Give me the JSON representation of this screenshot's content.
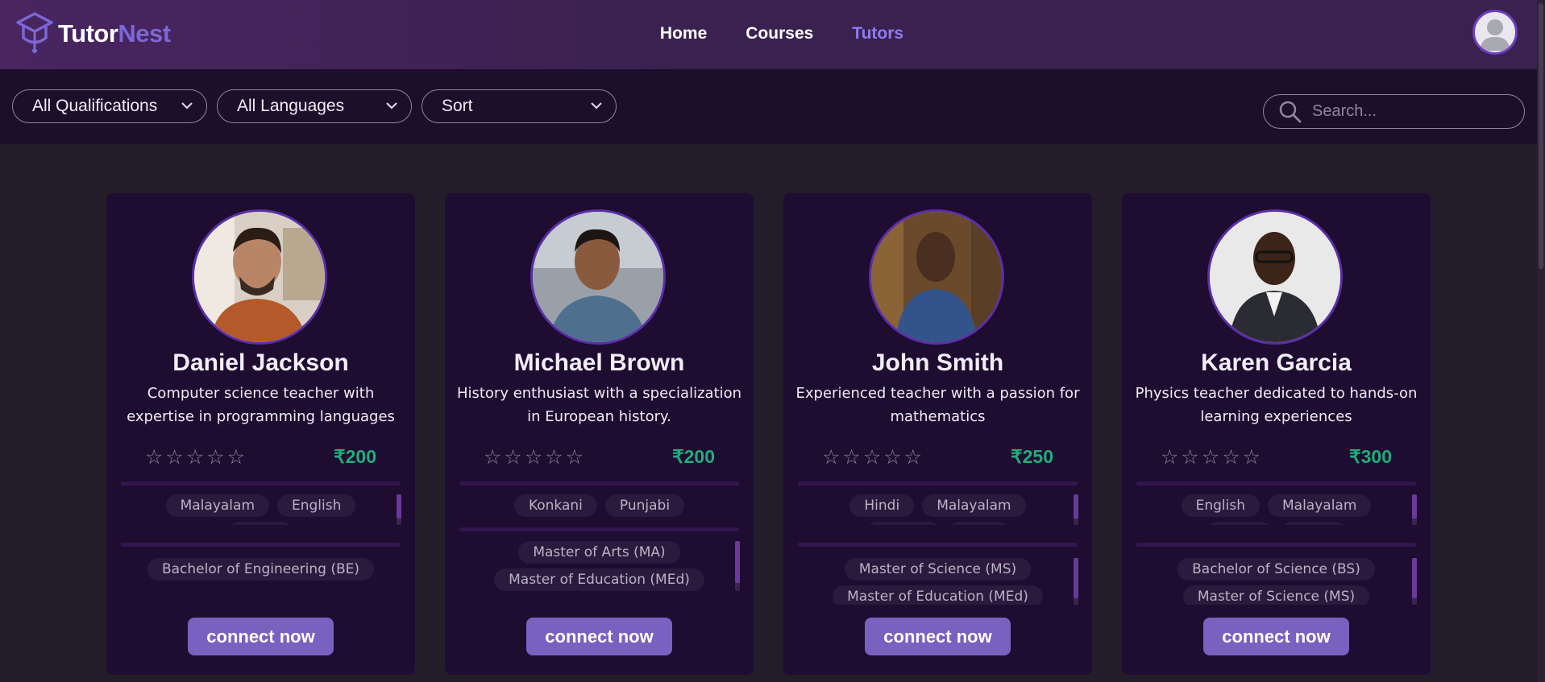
{
  "brand": {
    "part1": "Tutor",
    "part2": "Nest"
  },
  "nav": [
    {
      "label": "Home"
    },
    {
      "label": "Courses"
    },
    {
      "label": "Tutors"
    }
  ],
  "filters": {
    "qualifications": "All Qualifications",
    "languages": "All Languages",
    "sort": "Sort"
  },
  "search": {
    "placeholder": "Search..."
  },
  "colors": {
    "accent": "#8c7df0",
    "price": "#1fae7a",
    "button": "#7961bf"
  },
  "tutors": [
    {
      "name": "Daniel Jackson",
      "description": "Computer science teacher with expertise in programming languages",
      "rating": "☆☆☆☆☆",
      "price": "₹200",
      "languages": [
        "Malayalam",
        "English"
      ],
      "qualifications": [
        "Bachelor of Engineering (BE)"
      ],
      "button": "connect now"
    },
    {
      "name": "Michael Brown",
      "description": "History enthusiast with a specialization in European history.",
      "rating": "☆☆☆☆☆",
      "price": "₹200",
      "languages": [
        "Konkani",
        "Punjabi"
      ],
      "qualifications": [
        "Master of Arts (MA)",
        "Master of Education (MEd)"
      ],
      "button": "connect now"
    },
    {
      "name": "John Smith",
      "description": "Experienced teacher with a passion for mathematics",
      "rating": "☆☆☆☆☆",
      "price": "₹250",
      "languages": [
        "Hindi",
        "Malayalam"
      ],
      "qualifications": [
        "Master of Science (MS)",
        "Master of Education (MEd)"
      ],
      "button": "connect now"
    },
    {
      "name": "Karen Garcia",
      "description": "Physics teacher dedicated to hands-on learning experiences",
      "rating": "☆☆☆☆☆",
      "price": "₹300",
      "languages": [
        "English",
        "Malayalam"
      ],
      "qualifications": [
        "Bachelor of Science (BS)",
        "Master of Science (MS)"
      ],
      "button": "connect now"
    }
  ]
}
